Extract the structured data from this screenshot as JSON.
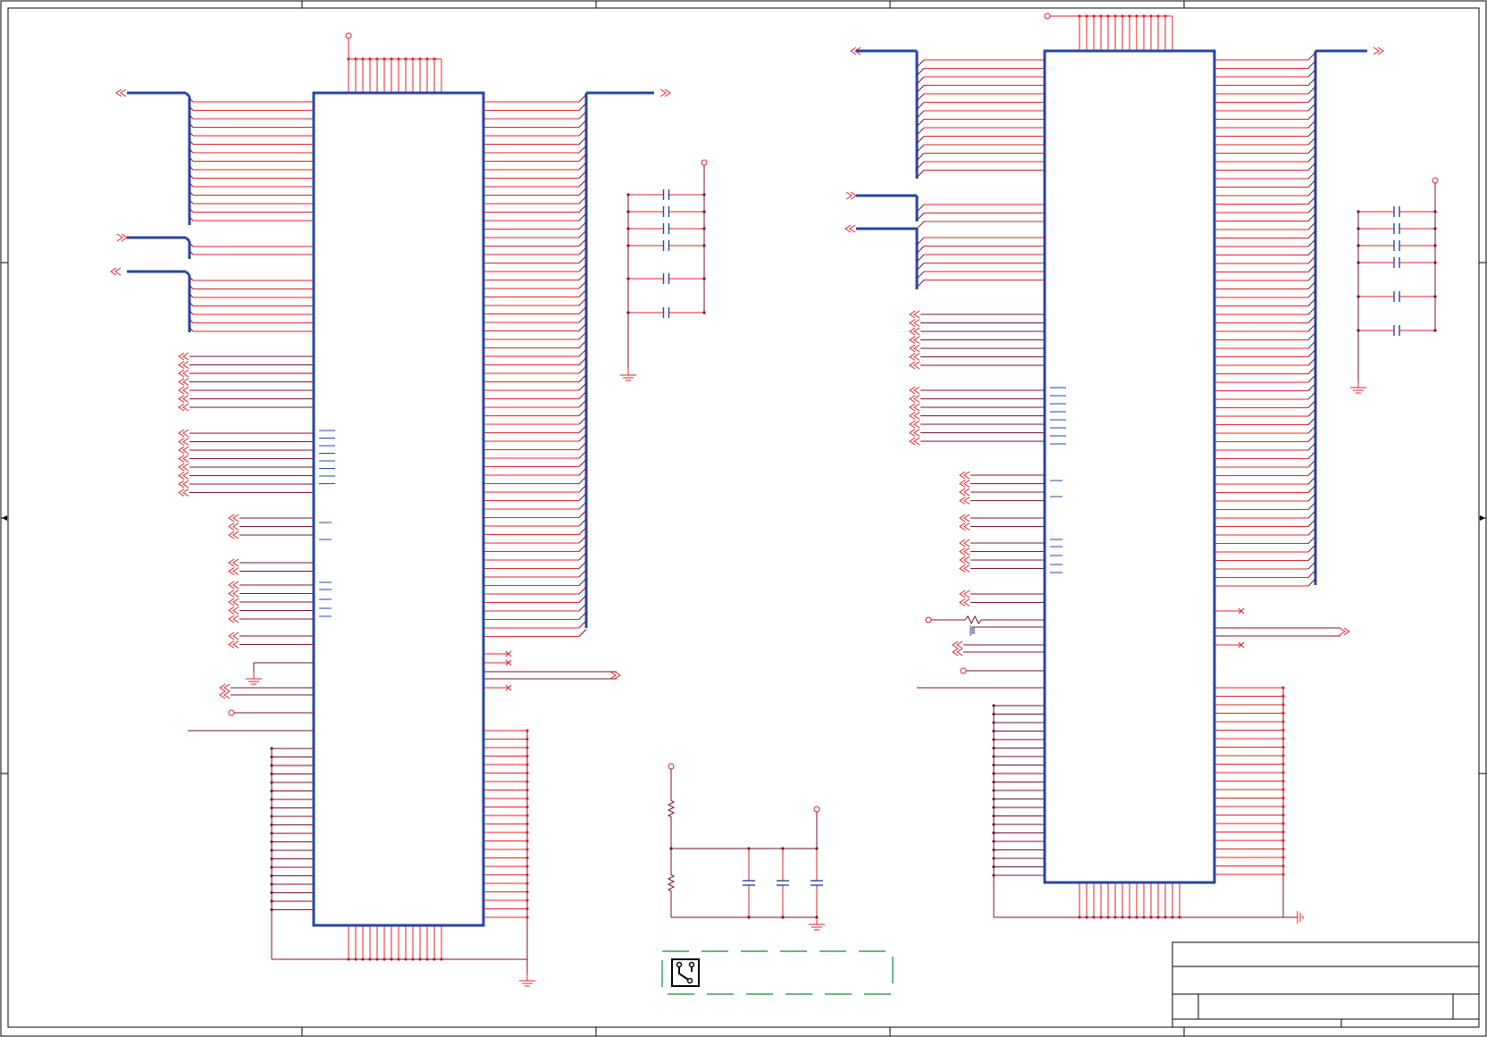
{
  "colors": {
    "wire": "#e0202a",
    "net": "#7a1030",
    "bus": "#2a44a0",
    "component": "#2a44a0",
    "frame": "#000000",
    "annotation": "#0a8a3a"
  },
  "icons": [
    "pcb-logo-icon",
    "ground-icon",
    "power-port-icon",
    "bus-connector-icon"
  ],
  "title_block": {
    "title": "",
    "sheet": "",
    "revision": ""
  }
}
